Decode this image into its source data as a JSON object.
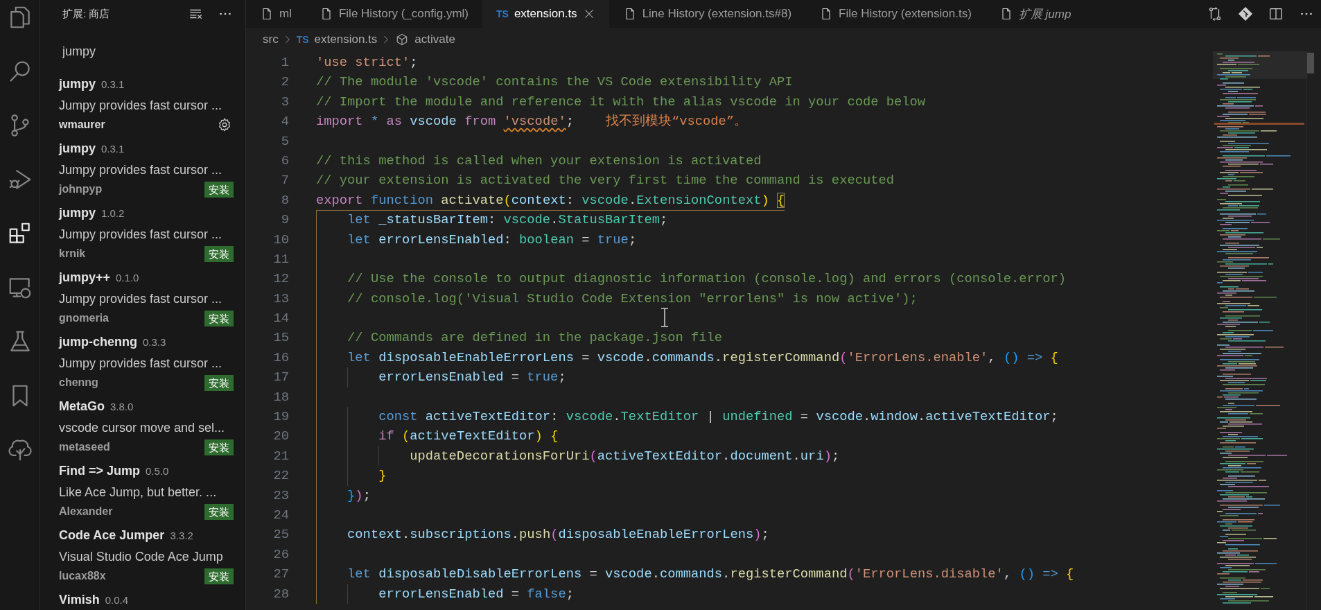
{
  "activity_bar": [
    {
      "kind": "files",
      "selected": false
    },
    {
      "kind": "search",
      "selected": false
    },
    {
      "kind": "branch",
      "selected": false
    },
    {
      "kind": "debug",
      "selected": false
    },
    {
      "kind": "blocks",
      "selected": true
    },
    {
      "kind": "monitor",
      "selected": false
    },
    {
      "kind": "flask",
      "selected": false
    },
    {
      "kind": "bookmark",
      "selected": false
    },
    {
      "kind": "tree",
      "selected": false
    }
  ],
  "sidebar": {
    "title": "扩展: 商店",
    "search": {
      "value": "jumpy"
    },
    "items": [
      {
        "name": "jumpy",
        "version": "0.3.1",
        "description": "Jumpy provides fast cursor ...",
        "publisher": "wmaurer",
        "action": {
          "kind": "manage"
        }
      },
      {
        "name": "jumpy",
        "version": "0.3.1",
        "description": "Jumpy provides fast cursor ...",
        "publisher": "johnpyp",
        "action": {
          "kind": "install",
          "label": "安装"
        }
      },
      {
        "name": "jumpy",
        "version": "1.0.2",
        "description": "Jumpy provides fast cursor ...",
        "publisher": "krnik",
        "action": {
          "kind": "install",
          "label": "安装"
        }
      },
      {
        "name": "jumpy++",
        "version": "0.1.0",
        "description": "Jumpy provides fast cursor ...",
        "publisher": "gnomeria",
        "action": {
          "kind": "install",
          "label": "安装"
        }
      },
      {
        "name": "jump-chenng",
        "version": "0.3.3",
        "description": "Jumpy provides fast cursor ...",
        "publisher": "chenng",
        "action": {
          "kind": "install",
          "label": "安装"
        }
      },
      {
        "name": "MetaGo",
        "version": "3.8.0",
        "description": "vscode cursor move and sel...",
        "publisher": "metaseed",
        "action": {
          "kind": "install",
          "label": "安装"
        }
      },
      {
        "name": "Find => Jump",
        "version": "0.5.0",
        "description": "Like Ace Jump, but better. ...",
        "publisher": "Alexander",
        "action": {
          "kind": "install",
          "label": "安装"
        }
      },
      {
        "name": "Code Ace Jumper",
        "version": "3.3.2",
        "description": "Visual Studio Code Ace Jump",
        "publisher": "lucax88x",
        "action": {
          "kind": "install",
          "label": "安装"
        }
      },
      {
        "name": "Vimish",
        "version": "0.0.4"
      }
    ]
  },
  "tabs": [
    {
      "label": "ml",
      "kind": "file",
      "selected": false,
      "preview": false
    },
    {
      "label": "File History (_config.yml)",
      "kind": "file",
      "selected": false,
      "preview": false
    },
    {
      "label": "extension.ts",
      "kind": "typescript",
      "icon_text": "TS",
      "selected": true,
      "preview": false
    },
    {
      "label": "Line History (extension.ts#8)",
      "kind": "file",
      "selected": false,
      "preview": false
    },
    {
      "label": "File History (extension.ts)",
      "kind": "file",
      "selected": false,
      "preview": false
    },
    {
      "label": "扩展 jump",
      "kind": "file",
      "selected": false,
      "preview": true
    }
  ],
  "breadcrumb": [
    {
      "kind": "folder",
      "text": "src"
    },
    {
      "kind": "typescript",
      "icon_text": "TS",
      "text": "extension.ts"
    },
    {
      "kind": "symbol",
      "text": "activate"
    }
  ],
  "code": [
    {
      "number": "1",
      "scoped": false,
      "tokens": [
        {
          "kind": "string",
          "text": "'use strict'"
        },
        {
          "kind": "plain",
          "text": ";"
        }
      ]
    },
    {
      "number": "2",
      "scoped": false,
      "tokens": [
        {
          "kind": "comment",
          "text": "// The module 'vscode' contains the VS Code extensibility API"
        }
      ]
    },
    {
      "number": "3",
      "scoped": false,
      "tokens": [
        {
          "kind": "comment",
          "text": "// Import the module and reference it with the alias vscode in your code below"
        }
      ]
    },
    {
      "number": "4",
      "scoped": false,
      "tokens": [
        {
          "kind": "control",
          "text": "import "
        },
        {
          "kind": "keyword",
          "text": "* "
        },
        {
          "kind": "control",
          "text": "as "
        },
        {
          "kind": "variable",
          "text": "vscode "
        },
        {
          "kind": "control",
          "text": "from "
        },
        {
          "kind": "string_error",
          "text": "'vscode'"
        },
        {
          "kind": "plain",
          "text": ";"
        }
      ],
      "message": "找不到模块“vscode”。"
    },
    {
      "number": "5",
      "scoped": false
    },
    {
      "number": "6",
      "scoped": false,
      "tokens": [
        {
          "kind": "comment",
          "text": "// this method is called when your extension is activated"
        }
      ]
    },
    {
      "number": "7",
      "scoped": false,
      "tokens": [
        {
          "kind": "comment",
          "text": "// your extension is activated the very first time the command is executed"
        }
      ]
    },
    {
      "number": "8",
      "scoped": false,
      "tokens": [
        {
          "kind": "control",
          "text": "export "
        },
        {
          "kind": "keyword",
          "text": "function "
        },
        {
          "kind": "function",
          "text": "activate"
        },
        {
          "kind": "bracket1",
          "text": "("
        },
        {
          "kind": "variable",
          "text": "context"
        },
        {
          "kind": "plain",
          "text": ": "
        },
        {
          "kind": "type",
          "text": "vscode"
        },
        {
          "kind": "plain",
          "text": "."
        },
        {
          "kind": "type",
          "text": "ExtensionContext"
        },
        {
          "kind": "bracket1",
          "text": ") "
        },
        {
          "kind": "bracket_match",
          "text": "{"
        }
      ]
    },
    {
      "number": "9",
      "scoped": true,
      "tokens": [
        {
          "kind": "keyword",
          "text": "    let "
        },
        {
          "kind": "variable",
          "text": "_statusBarItem"
        },
        {
          "kind": "plain",
          "text": ": "
        },
        {
          "kind": "type",
          "text": "vscode"
        },
        {
          "kind": "plain",
          "text": "."
        },
        {
          "kind": "type",
          "text": "StatusBarItem"
        },
        {
          "kind": "plain",
          "text": ";"
        }
      ]
    },
    {
      "number": "10",
      "scoped": true,
      "tokens": [
        {
          "kind": "keyword",
          "text": "    let "
        },
        {
          "kind": "variable",
          "text": "errorLensEnabled"
        },
        {
          "kind": "plain",
          "text": ": "
        },
        {
          "kind": "type",
          "text": "boolean"
        },
        {
          "kind": "plain",
          "text": " = "
        },
        {
          "kind": "keyword",
          "text": "true"
        },
        {
          "kind": "plain",
          "text": ";"
        }
      ]
    },
    {
      "number": "11",
      "scoped": true
    },
    {
      "number": "12",
      "scoped": true,
      "tokens": [
        {
          "kind": "comment",
          "text": "    // Use the console to output diagnostic information (console.log) and errors (console.error)"
        }
      ]
    },
    {
      "number": "13",
      "scoped": true,
      "tokens": [
        {
          "kind": "comment",
          "text": "    // console.log('Visual Studio Code Extension \"errorlens\" is now active');"
        }
      ]
    },
    {
      "number": "14",
      "scoped": true
    },
    {
      "number": "15",
      "scoped": true,
      "tokens": [
        {
          "kind": "comment",
          "text": "    // Commands are defined in the package.json file"
        }
      ]
    },
    {
      "number": "16",
      "scoped": true,
      "tokens": [
        {
          "kind": "keyword",
          "text": "    let "
        },
        {
          "kind": "variable",
          "text": "disposableEnableErrorLens"
        },
        {
          "kind": "plain",
          "text": " = "
        },
        {
          "kind": "variable",
          "text": "vscode"
        },
        {
          "kind": "plain",
          "text": "."
        },
        {
          "kind": "variable",
          "text": "commands"
        },
        {
          "kind": "plain",
          "text": "."
        },
        {
          "kind": "function",
          "text": "registerCommand"
        },
        {
          "kind": "bracket2",
          "text": "("
        },
        {
          "kind": "string",
          "text": "'ErrorLens.enable'"
        },
        {
          "kind": "plain",
          "text": ", "
        },
        {
          "kind": "bracket3",
          "text": "() "
        },
        {
          "kind": "keyword",
          "text": "=> "
        },
        {
          "kind": "bracket1",
          "text": "{"
        }
      ]
    },
    {
      "number": "17",
      "scoped": true,
      "tokens": [
        {
          "kind": "variable",
          "text": "        errorLensEnabled"
        },
        {
          "kind": "plain",
          "text": " = "
        },
        {
          "kind": "keyword",
          "text": "true"
        },
        {
          "kind": "plain",
          "text": ";"
        }
      ]
    },
    {
      "number": "18",
      "scoped": true
    },
    {
      "number": "19",
      "scoped": true,
      "tokens": [
        {
          "kind": "keyword",
          "text": "        const "
        },
        {
          "kind": "variable",
          "text": "activeTextEditor"
        },
        {
          "kind": "plain",
          "text": ": "
        },
        {
          "kind": "type",
          "text": "vscode"
        },
        {
          "kind": "plain",
          "text": "."
        },
        {
          "kind": "type",
          "text": "TextEditor"
        },
        {
          "kind": "plain",
          "text": " | "
        },
        {
          "kind": "type",
          "text": "undefined"
        },
        {
          "kind": "plain",
          "text": " = "
        },
        {
          "kind": "variable",
          "text": "vscode"
        },
        {
          "kind": "plain",
          "text": "."
        },
        {
          "kind": "variable",
          "text": "window"
        },
        {
          "kind": "plain",
          "text": "."
        },
        {
          "kind": "variable",
          "text": "activeTextEditor"
        },
        {
          "kind": "plain",
          "text": ";"
        }
      ]
    },
    {
      "number": "20",
      "scoped": true,
      "tokens": [
        {
          "kind": "control",
          "text": "        if "
        },
        {
          "kind": "bracket1",
          "text": "("
        },
        {
          "kind": "variable",
          "text": "activeTextEditor"
        },
        {
          "kind": "bracket1",
          "text": ") "
        },
        {
          "kind": "bracket1",
          "text": "{"
        }
      ]
    },
    {
      "number": "21",
      "scoped": true,
      "tokens": [
        {
          "kind": "function",
          "text": "            updateDecorationsForUri"
        },
        {
          "kind": "bracket2",
          "text": "("
        },
        {
          "kind": "variable",
          "text": "activeTextEditor"
        },
        {
          "kind": "plain",
          "text": "."
        },
        {
          "kind": "variable",
          "text": "document"
        },
        {
          "kind": "plain",
          "text": "."
        },
        {
          "kind": "variable",
          "text": "uri"
        },
        {
          "kind": "bracket2",
          "text": ")"
        },
        {
          "kind": "plain",
          "text": ";"
        }
      ]
    },
    {
      "number": "22",
      "scoped": true,
      "tokens": [
        {
          "kind": "bracket1",
          "text": "        }"
        }
      ]
    },
    {
      "number": "23",
      "scoped": true,
      "tokens": [
        {
          "kind": "bracket3",
          "text": "    }"
        },
        {
          "kind": "bracket2",
          "text": ")"
        },
        {
          "kind": "plain",
          "text": ";"
        }
      ]
    },
    {
      "number": "24",
      "scoped": true
    },
    {
      "number": "25",
      "scoped": true,
      "tokens": [
        {
          "kind": "variable",
          "text": "    context"
        },
        {
          "kind": "plain",
          "text": "."
        },
        {
          "kind": "variable",
          "text": "subscriptions"
        },
        {
          "kind": "plain",
          "text": "."
        },
        {
          "kind": "function",
          "text": "push"
        },
        {
          "kind": "bracket2",
          "text": "("
        },
        {
          "kind": "variable",
          "text": "disposableEnableErrorLens"
        },
        {
          "kind": "bracket2",
          "text": ")"
        },
        {
          "kind": "plain",
          "text": ";"
        }
      ]
    },
    {
      "number": "26",
      "scoped": true
    },
    {
      "number": "27",
      "scoped": true,
      "tokens": [
        {
          "kind": "keyword",
          "text": "    let "
        },
        {
          "kind": "variable",
          "text": "disposableDisableErrorLens"
        },
        {
          "kind": "plain",
          "text": " = "
        },
        {
          "kind": "variable",
          "text": "vscode"
        },
        {
          "kind": "plain",
          "text": "."
        },
        {
          "kind": "variable",
          "text": "commands"
        },
        {
          "kind": "plain",
          "text": "."
        },
        {
          "kind": "function",
          "text": "registerCommand"
        },
        {
          "kind": "bracket2",
          "text": "("
        },
        {
          "kind": "string",
          "text": "'ErrorLens.disable'"
        },
        {
          "kind": "plain",
          "text": ", "
        },
        {
          "kind": "bracket3",
          "text": "() "
        },
        {
          "kind": "keyword",
          "text": "=> "
        },
        {
          "kind": "bracket1",
          "text": "{"
        }
      ]
    },
    {
      "number": "28",
      "scoped": true,
      "tokens": [
        {
          "kind": "variable",
          "text": "        errorLensEnabled"
        },
        {
          "kind": "plain",
          "text": " = "
        },
        {
          "kind": "keyword",
          "text": "false"
        },
        {
          "kind": "plain",
          "text": ";"
        }
      ]
    }
  ]
}
